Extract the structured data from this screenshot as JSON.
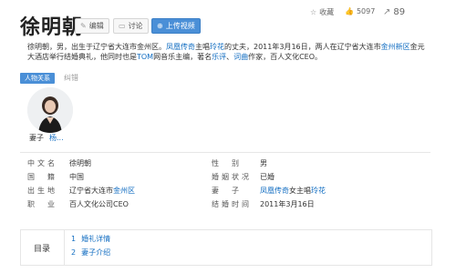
{
  "title": "徐明朝",
  "buttons": {
    "edit": "编辑",
    "discuss": "讨论",
    "upload_video": "上传视频"
  },
  "stats": {
    "collect": "收藏",
    "likes": "5097",
    "shares": "89"
  },
  "intro": {
    "p1": "徐明朝，男，出生于辽宁省大连市金州区。",
    "l1": "凤凰传奇",
    "p2": "主唱",
    "l2": "玲花",
    "p3": "的丈夫，2011年3月16日，两人在辽宁省大连市",
    "l3": "金州新区",
    "p4": "金元大酒店举行结婚典礼，他同时也是",
    "l4": "TOM",
    "p5": "网音乐主编，著名",
    "l5": "乐评",
    "p6": "、",
    "l6": "词曲",
    "p7": "作家，百人文化CEO。"
  },
  "tabs": {
    "relations": "人物关系",
    "correct": "纠错"
  },
  "relation": {
    "role": "妻子",
    "name": "杨..."
  },
  "info": {
    "left": [
      {
        "k": "中文名",
        "v": "徐明朝"
      },
      {
        "k": "国　籍",
        "v": "中国"
      },
      {
        "k": "出生地",
        "v": "辽宁省大连市金州区",
        "link": "金州区"
      },
      {
        "k": "职　业",
        "v": "百人文化公司CEO"
      }
    ],
    "right": [
      {
        "k": "性　别",
        "v": "男"
      },
      {
        "k": "婚姻状况",
        "v": "已婚"
      },
      {
        "k": "妻　子",
        "v1": "凤凰传奇",
        "v2": "女主唱",
        "v3": "玲花"
      },
      {
        "k": "结婚时间",
        "v": "2011年3月16日"
      }
    ]
  },
  "toc": {
    "label": "目录",
    "items": [
      {
        "n": "1",
        "label": "婚礼详情"
      },
      {
        "n": "2",
        "label": "妻子介绍"
      }
    ]
  },
  "colors": {
    "link": "#136ec2",
    "primary": "#4a8fd7"
  }
}
